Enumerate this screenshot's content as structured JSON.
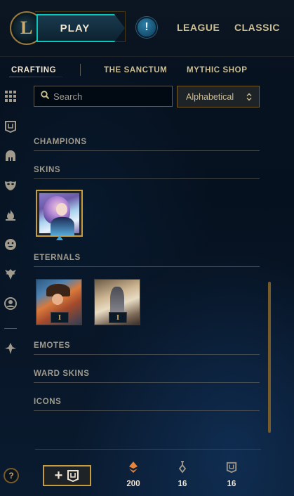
{
  "topbar": {
    "play_label": "PLAY",
    "alert_symbol": "!",
    "nav": [
      "LEAGUE",
      "CLASSIC"
    ]
  },
  "subnav": {
    "items": [
      "CRAFTING",
      "THE SANCTUM",
      "MYTHIC SHOP"
    ],
    "active": "CRAFTING"
  },
  "search": {
    "placeholder": "Search",
    "value": "",
    "sort_value": "Alphabetical"
  },
  "sections": {
    "champions": "CHAMPIONS",
    "skins": "SKINS",
    "eternals": "ETERNALS",
    "emotes": "EMOTES",
    "ward_skins": "WARD SKINS",
    "icons": "ICONS"
  },
  "eternals": [
    {
      "badge": "I"
    },
    {
      "badge": "I"
    }
  ],
  "footer": {
    "help_symbol": "?",
    "add_symbol": "+",
    "currencies": [
      {
        "icon": "orange-essence-icon",
        "value": "200"
      },
      {
        "icon": "key-fragment-icon",
        "value": "16"
      },
      {
        "icon": "chest-icon",
        "value": "16"
      }
    ]
  },
  "colors": {
    "gold": "#c8aa6e",
    "teal": "#0ac8b9",
    "background": "#010a13",
    "orange_essence": "#e8843a"
  }
}
